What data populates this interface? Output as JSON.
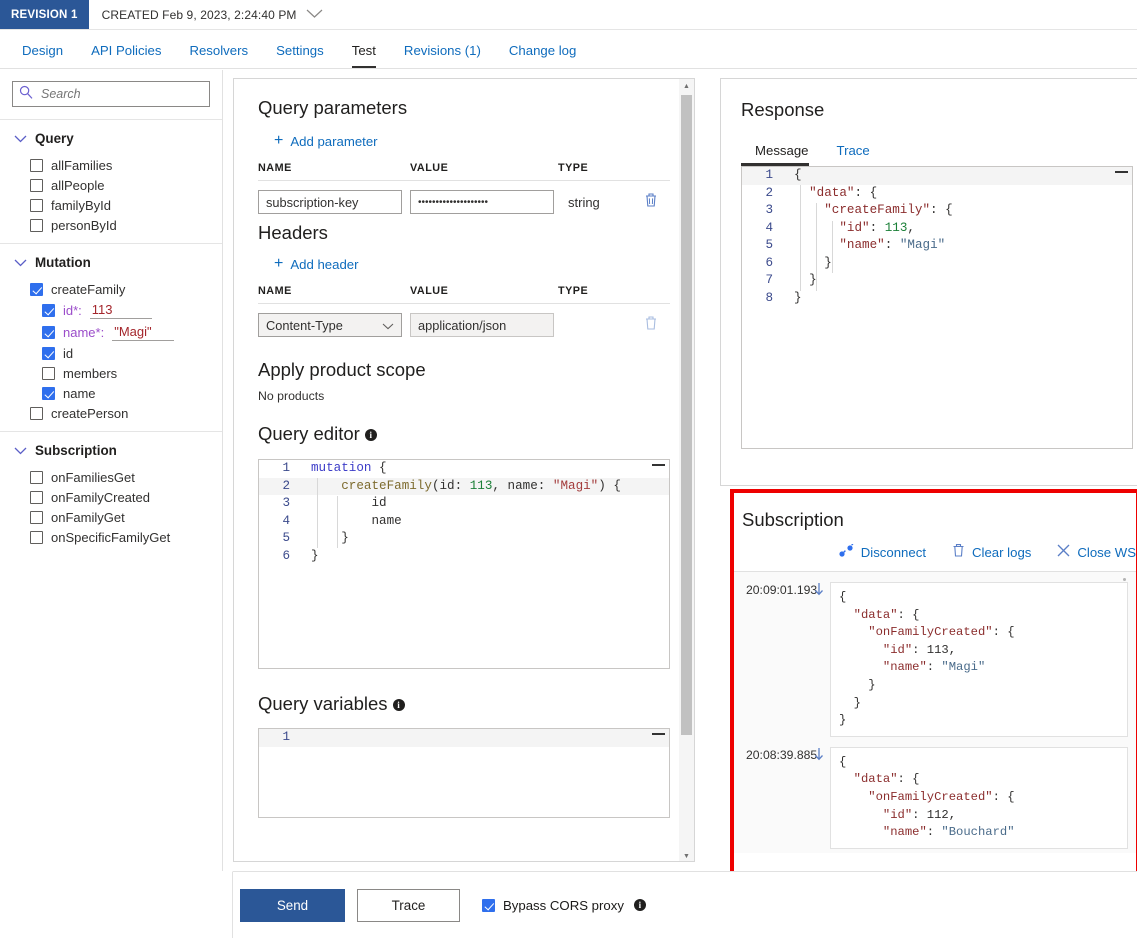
{
  "revision": {
    "badge": "REVISION 1",
    "created": "CREATED Feb 9, 2023, 2:24:40 PM",
    "chevron_icon": "chevron-down-icon"
  },
  "tabs": [
    {
      "label": "Design",
      "active": false
    },
    {
      "label": "API Policies",
      "active": false
    },
    {
      "label": "Resolvers",
      "active": false
    },
    {
      "label": "Settings",
      "active": false
    },
    {
      "label": "Test",
      "active": true
    },
    {
      "label": "Revisions (1)",
      "active": false
    },
    {
      "label": "Change log",
      "active": false
    }
  ],
  "sidebar": {
    "search": {
      "placeholder": "Search",
      "value": "",
      "icon": "search-icon"
    },
    "groups": [
      {
        "name": "Query",
        "expanded": true,
        "items": [
          {
            "label": "allFamilies",
            "checked": false,
            "level": 1
          },
          {
            "label": "allPeople",
            "checked": false,
            "level": 1
          },
          {
            "label": "familyById",
            "checked": false,
            "level": 1
          },
          {
            "label": "personById",
            "checked": false,
            "level": 1
          }
        ]
      },
      {
        "name": "Mutation",
        "expanded": true,
        "items": [
          {
            "label": "createFamily",
            "checked": true,
            "level": 1
          },
          {
            "label": "id*:",
            "checked": true,
            "level": 2,
            "arg": true,
            "value": "113"
          },
          {
            "label": "name*:",
            "checked": true,
            "level": 2,
            "arg": true,
            "value": "\"Magi\""
          },
          {
            "label": "id",
            "checked": true,
            "level": 2
          },
          {
            "label": "members",
            "checked": false,
            "level": 2
          },
          {
            "label": "name",
            "checked": true,
            "level": 2
          },
          {
            "label": "createPerson",
            "checked": false,
            "level": 1
          }
        ]
      },
      {
        "name": "Subscription",
        "expanded": true,
        "items": [
          {
            "label": "onFamiliesGet",
            "checked": false,
            "level": 1
          },
          {
            "label": "onFamilyCreated",
            "checked": false,
            "level": 1
          },
          {
            "label": "onFamilyGet",
            "checked": false,
            "level": 1
          },
          {
            "label": "onSpecificFamilyGet",
            "checked": false,
            "level": 1
          }
        ]
      }
    ]
  },
  "center": {
    "query_parameters": {
      "title": "Query parameters",
      "add_label": "Add parameter",
      "columns": [
        "NAME",
        "VALUE",
        "TYPE"
      ],
      "rows": [
        {
          "name": "subscription-key",
          "value": "••••••••••••••••••••",
          "type": "string",
          "delete_icon": "trash-icon"
        }
      ]
    },
    "headers": {
      "title": "Headers",
      "add_label": "Add header",
      "columns": [
        "NAME",
        "VALUE",
        "TYPE"
      ],
      "rows": [
        {
          "name": "Content-Type",
          "value": "application/json",
          "type": "",
          "delete_icon": "trash-icon"
        }
      ]
    },
    "product_scope": {
      "title": "Apply product scope",
      "empty_text": "No products"
    },
    "query_editor": {
      "title": "Query editor",
      "info_icon": "info-icon",
      "lines": [
        {
          "n": "1",
          "tokens": [
            {
              "t": "mutation",
              "c": "k-kw"
            },
            {
              "t": " {",
              "c": "k-pl"
            }
          ]
        },
        {
          "n": "2",
          "current": true,
          "tokens": [
            {
              "t": "    ",
              "c": "k-pl"
            },
            {
              "t": "createFamily",
              "c": "k-fn"
            },
            {
              "t": "(id: ",
              "c": "k-pl"
            },
            {
              "t": "113",
              "c": "k-num"
            },
            {
              "t": ", name: ",
              "c": "k-pl"
            },
            {
              "t": "\"Magi\"",
              "c": "k-str"
            },
            {
              "t": ") {",
              "c": "k-pl"
            }
          ]
        },
        {
          "n": "3",
          "tokens": [
            {
              "t": "        id",
              "c": "k-pl"
            }
          ]
        },
        {
          "n": "4",
          "tokens": [
            {
              "t": "        name",
              "c": "k-pl"
            }
          ]
        },
        {
          "n": "5",
          "tokens": [
            {
              "t": "    }",
              "c": "k-pl"
            }
          ]
        },
        {
          "n": "6",
          "tokens": [
            {
              "t": "}",
              "c": "k-pl"
            }
          ]
        }
      ]
    },
    "query_variables": {
      "title": "Query variables",
      "info_icon": "info-icon",
      "lines": [
        {
          "n": "1",
          "current": true,
          "tokens": [
            {
              "t": "",
              "c": "k-pl"
            }
          ]
        }
      ]
    }
  },
  "response": {
    "title": "Response",
    "tabs": [
      {
        "label": "Message",
        "active": true
      },
      {
        "label": "Trace",
        "active": false
      }
    ],
    "lines": [
      {
        "n": "1",
        "current": true,
        "tokens": [
          {
            "t": "{",
            "c": "k-pl"
          }
        ]
      },
      {
        "n": "2",
        "tokens": [
          {
            "t": "  ",
            "c": "k-pl"
          },
          {
            "t": "\"data\"",
            "c": "k-key"
          },
          {
            "t": ": {",
            "c": "k-pl"
          }
        ]
      },
      {
        "n": "3",
        "tokens": [
          {
            "t": "    ",
            "c": "k-pl"
          },
          {
            "t": "\"createFamily\"",
            "c": "k-key"
          },
          {
            "t": ": {",
            "c": "k-pl"
          }
        ]
      },
      {
        "n": "4",
        "tokens": [
          {
            "t": "      ",
            "c": "k-pl"
          },
          {
            "t": "\"id\"",
            "c": "k-key"
          },
          {
            "t": ": ",
            "c": "k-pl"
          },
          {
            "t": "113",
            "c": "k-num"
          },
          {
            "t": ",",
            "c": "k-pl"
          }
        ]
      },
      {
        "n": "5",
        "tokens": [
          {
            "t": "      ",
            "c": "k-pl"
          },
          {
            "t": "\"name\"",
            "c": "k-key"
          },
          {
            "t": ": ",
            "c": "k-pl"
          },
          {
            "t": "\"Magi\"",
            "c": "k-sval"
          }
        ]
      },
      {
        "n": "6",
        "tokens": [
          {
            "t": "    }",
            "c": "k-pl"
          }
        ]
      },
      {
        "n": "7",
        "tokens": [
          {
            "t": "  }",
            "c": "k-pl"
          }
        ]
      },
      {
        "n": "8",
        "tokens": [
          {
            "t": "}",
            "c": "k-pl"
          }
        ]
      }
    ]
  },
  "subscription": {
    "title": "Subscription",
    "highlight_color": "#ee0000",
    "toolbar": [
      {
        "label": "Disconnect",
        "icon": "plug-disconnect-icon"
      },
      {
        "label": "Clear logs",
        "icon": "trash-icon"
      },
      {
        "label": "Close WS",
        "icon": "close-icon"
      }
    ],
    "logs": [
      {
        "timestamp": "20:09:01.193",
        "direction_icon": "arrow-down-icon",
        "body_lines": [
          [
            {
              "t": "{",
              "c": "k-pl"
            }
          ],
          [
            {
              "t": "  ",
              "c": "k-pl"
            },
            {
              "t": "\"data\"",
              "c": "k-key"
            },
            {
              "t": ": {",
              "c": "k-pl"
            }
          ],
          [
            {
              "t": "    ",
              "c": "k-pl"
            },
            {
              "t": "\"onFamilyCreated\"",
              "c": "k-key"
            },
            {
              "t": ": {",
              "c": "k-pl"
            }
          ],
          [
            {
              "t": "      ",
              "c": "k-pl"
            },
            {
              "t": "\"id\"",
              "c": "k-key"
            },
            {
              "t": ": ",
              "c": "k-pl"
            },
            {
              "t": "113",
              "c": "k-pl"
            },
            {
              "t": ",",
              "c": "k-pl"
            }
          ],
          [
            {
              "t": "      ",
              "c": "k-pl"
            },
            {
              "t": "\"name\"",
              "c": "k-key"
            },
            {
              "t": ": ",
              "c": "k-pl"
            },
            {
              "t": "\"Magi\"",
              "c": "k-sval"
            }
          ],
          [
            {
              "t": "    }",
              "c": "k-pl"
            }
          ],
          [
            {
              "t": "  }",
              "c": "k-pl"
            }
          ],
          [
            {
              "t": "}",
              "c": "k-pl"
            }
          ]
        ]
      },
      {
        "timestamp": "20:08:39.885",
        "direction_icon": "arrow-down-icon",
        "body_lines": [
          [
            {
              "t": "{",
              "c": "k-pl"
            }
          ],
          [
            {
              "t": "  ",
              "c": "k-pl"
            },
            {
              "t": "\"data\"",
              "c": "k-key"
            },
            {
              "t": ": {",
              "c": "k-pl"
            }
          ],
          [
            {
              "t": "    ",
              "c": "k-pl"
            },
            {
              "t": "\"onFamilyCreated\"",
              "c": "k-key"
            },
            {
              "t": ": {",
              "c": "k-pl"
            }
          ],
          [
            {
              "t": "      ",
              "c": "k-pl"
            },
            {
              "t": "\"id\"",
              "c": "k-key"
            },
            {
              "t": ": ",
              "c": "k-pl"
            },
            {
              "t": "112",
              "c": "k-pl"
            },
            {
              "t": ",",
              "c": "k-pl"
            }
          ],
          [
            {
              "t": "      ",
              "c": "k-pl"
            },
            {
              "t": "\"name\"",
              "c": "k-key"
            },
            {
              "t": ": ",
              "c": "k-pl"
            },
            {
              "t": "\"Bouchard\"",
              "c": "k-sval"
            }
          ]
        ]
      }
    ]
  },
  "actions": {
    "send_label": "Send",
    "trace_label": "Trace",
    "cors_label": "Bypass CORS proxy",
    "cors_checked": true,
    "cors_info_icon": "info-icon"
  }
}
